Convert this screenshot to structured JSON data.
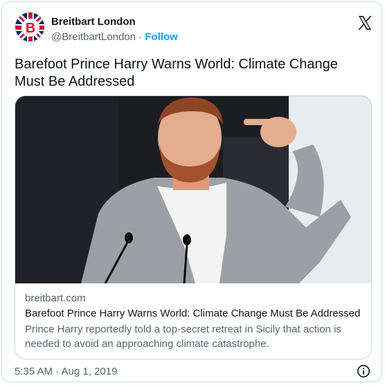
{
  "account": {
    "name": "Breitbart London",
    "handle": "@BreitbartLondon",
    "separator": " · ",
    "follow_label": "Follow",
    "avatar_letter": "B"
  },
  "tweet": {
    "text": "Barefoot Prince Harry Warns World: Climate Change Must Be Addressed"
  },
  "link_card": {
    "domain": "breitbart.com",
    "title": "Barefoot Prince Harry Warns World: Climate Change Must Be Addressed",
    "description": "Prince Harry reportedly told a top-secret retreat in Sicily that action is needed to avoid an approaching climate catastrophe."
  },
  "footer": {
    "timestamp": "5:35 AM · Aug 1, 2019"
  },
  "colors": {
    "accent": "#1d9bf0",
    "text_primary": "#0f1419",
    "text_secondary": "#536471",
    "border": "#cfd9de",
    "avatar_red": "#cf142b",
    "avatar_blue": "#00247d"
  },
  "icons": {
    "platform": "x-logo-icon",
    "info": "info-icon"
  }
}
